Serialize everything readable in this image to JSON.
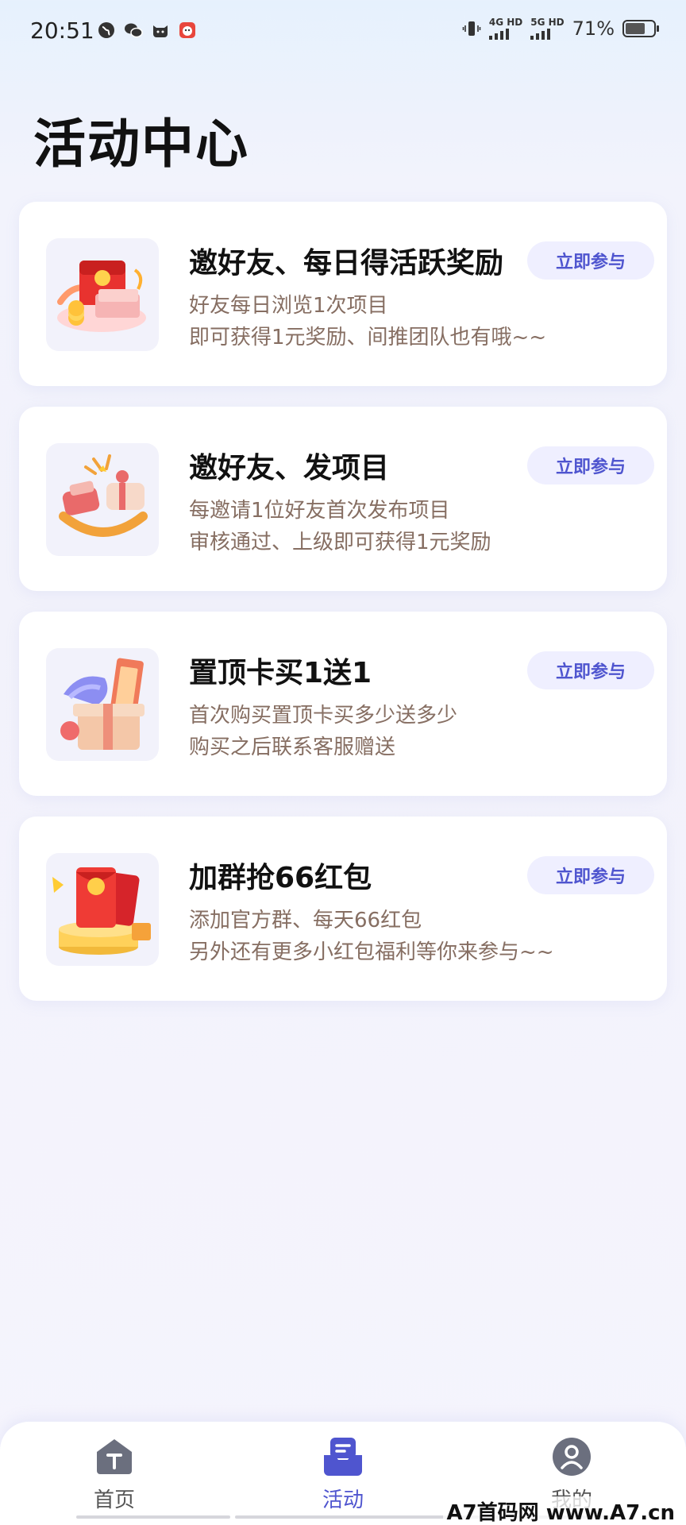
{
  "status_bar": {
    "time": "20:51",
    "network_1": "4G HD",
    "network_2": "5G HD",
    "battery": "71%",
    "battery_level": 0.71
  },
  "page_title": "活动中心",
  "activities": [
    {
      "title": "邀好友、每日得活跃奖励",
      "desc_line1": "好友每日浏览1次项目",
      "desc_line2": "即可获得1元奖励、间推团队也有哦~~",
      "button": "立即参与",
      "icon": "red-envelope-coins-icon"
    },
    {
      "title": "邀好友、发项目",
      "desc_line1": "每邀请1位好友首次发布项目",
      "desc_line2": "审核通过、上级即可获得1元奖励",
      "button": "立即参与",
      "icon": "celebration-gifts-icon"
    },
    {
      "title": "置顶卡买1送1",
      "desc_line1": "首次购买置顶卡买多少送多少",
      "desc_line2": "购买之后联系客服赠送",
      "button": "立即参与",
      "icon": "gift-box-ticket-icon"
    },
    {
      "title": "加群抢66红包",
      "desc_line1": "添加官方群、每天66红包",
      "desc_line2": "另外还有更多小红包福利等你来参与~~",
      "button": "立即参与",
      "icon": "red-packet-podium-icon"
    }
  ],
  "bottom_nav": {
    "items": [
      {
        "label": "首页",
        "icon": "home-icon"
      },
      {
        "label": "活动",
        "icon": "activity-inbox-icon",
        "active": true
      },
      {
        "label": "我的",
        "icon": "profile-icon"
      }
    ]
  },
  "watermark": "A7首码网 www.A7.cn",
  "colors": {
    "accent": "#4f55cf",
    "desc_text": "#866e62",
    "button_bg": "#efefff"
  }
}
